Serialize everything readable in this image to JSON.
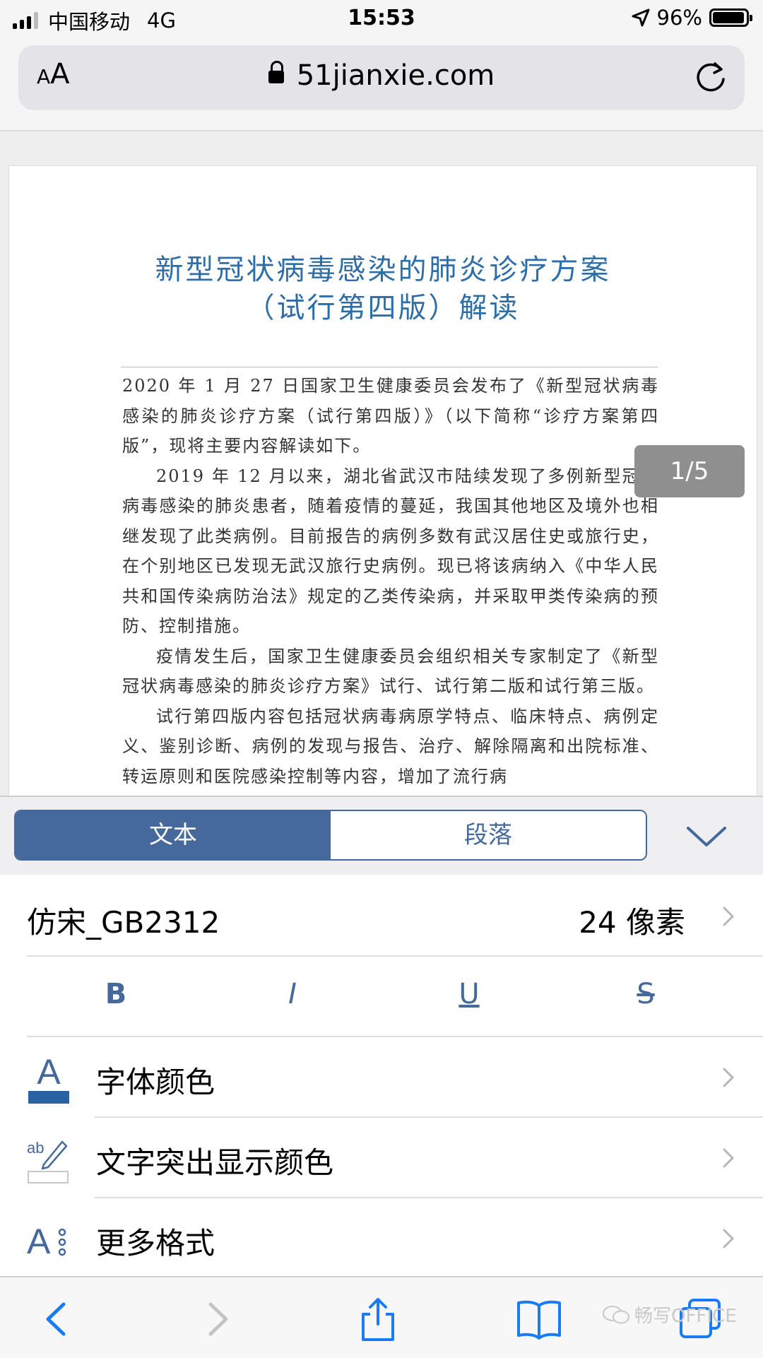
{
  "status_bar": {
    "carrier": "中国移动",
    "network": "4G",
    "time": "15:53",
    "battery": "96%",
    "battery_level": 0.96
  },
  "browser": {
    "text_size_button": "AA",
    "url": "51jianxie.com"
  },
  "document": {
    "title_line1": "新型冠状病毒感染的肺炎诊疗方案",
    "title_line2": "（试行第四版）解读",
    "paragraphs": [
      "2020 年 1 月 27 日国家卫生健康委员会发布了《新型冠状病毒感染的肺炎诊疗方案（试行第四版）》（以下简称“诊疗方案第四版”，现将主要内容解读如下。",
      "2019 年 12 月以来，湖北省武汉市陆续发现了多例新型冠状病毒感染的肺炎患者，随着疫情的蔓延，我国其他地区及境外也相继发现了此类病例。目前报告的病例多数有武汉居住史或旅行史，在个别地区已发现无武汉旅行史病例。现已将该病纳入《中华人民共和国传染病防治法》规定的乙类传染病，并采取甲类传染病的预防、控制措施。",
      "疫情发生后，国家卫生健康委员会组织相关专家制定了《新型冠状病毒感染的肺炎诊疗方案》试行、试行第二版和试行第三版。",
      "试行第四版内容包括冠状病毒病原学特点、临床特点、病例定义、鉴别诊断、病例的发现与报告、治疗、解除隔离和出院标准、转运原则和医院感染控制等内容，增加了流行病"
    ],
    "page_indicator": "1/5"
  },
  "format_panel": {
    "tabs": [
      {
        "label": "文本",
        "active": true
      },
      {
        "label": "段落",
        "active": false
      }
    ],
    "font_name": "仿宋_GB2312",
    "font_size": "24 像素",
    "styles": {
      "bold": "B",
      "italic": "I",
      "underline": "U",
      "strike": "S"
    },
    "items": [
      {
        "label": "字体颜色"
      },
      {
        "label": "文字突出显示颜色"
      },
      {
        "label": "更多格式"
      }
    ],
    "accent_color": "#44699a",
    "font_color_swatch": "#2b62a3"
  },
  "watermark": "畅写OFFICE"
}
